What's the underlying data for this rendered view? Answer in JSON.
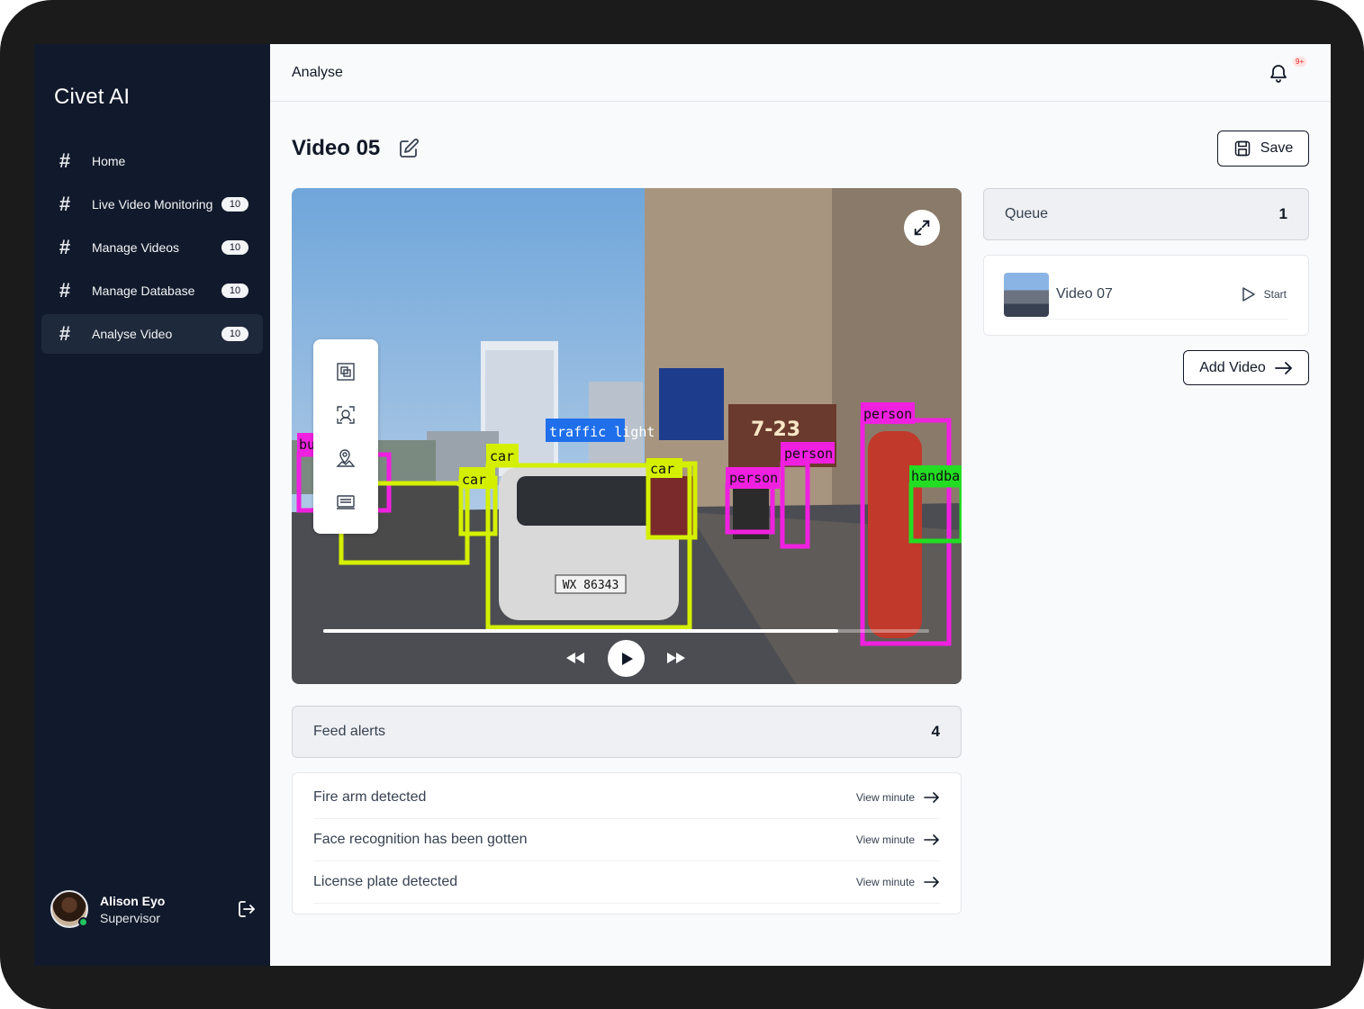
{
  "app": {
    "name": "Civet AI"
  },
  "sidebar": {
    "items": [
      {
        "label": "Home",
        "badge": ""
      },
      {
        "label": "Live Video Monitoring",
        "badge": "10"
      },
      {
        "label": "Manage Videos",
        "badge": "10"
      },
      {
        "label": "Manage Database",
        "badge": "10"
      },
      {
        "label": "Analyse Video",
        "badge": "10",
        "active": true
      }
    ],
    "user": {
      "name": "Alison Eyo",
      "role": "Supervisor"
    }
  },
  "topbar": {
    "title": "Analyse",
    "notifications_badge": "9+"
  },
  "page": {
    "title": "Video 05",
    "save_label": "Save"
  },
  "video": {
    "progress_fraction": 0.85,
    "detections": [
      "car",
      "car",
      "car",
      "car",
      "traffic light",
      "person",
      "person",
      "person",
      "handba",
      "bu"
    ],
    "plate": "WX 86343",
    "sign_shop": "7-23"
  },
  "queue": {
    "title": "Queue",
    "count": "1",
    "items": [
      {
        "name": "Video 07",
        "action": "Start"
      }
    ],
    "add_label": "Add Video"
  },
  "alerts": {
    "title": "Feed alerts",
    "count": "4",
    "items": [
      {
        "text": "Fire arm detected",
        "link": "View minute"
      },
      {
        "text": "Face recognition has been gotten",
        "link": "View minute"
      },
      {
        "text": "License plate detected",
        "link": "View minute"
      }
    ]
  },
  "colors": {
    "sidebar_bg": "#111a2c",
    "car_box": "#d4f000",
    "person_box": "#f020e0",
    "traffic_light_box": "#1f6feb",
    "handbag_box": "#22dd22"
  }
}
